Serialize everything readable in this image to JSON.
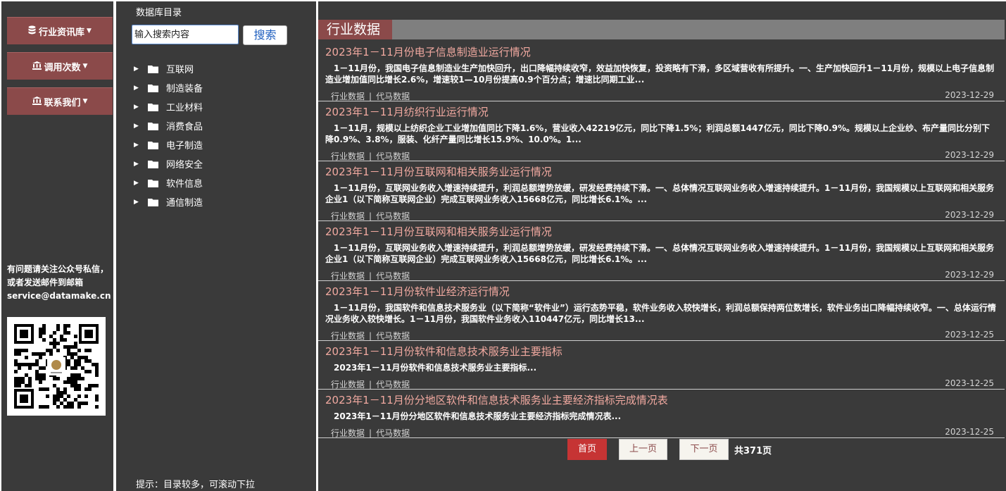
{
  "nav": {
    "items": [
      {
        "label": "行业资讯库",
        "icon": "database-icon"
      },
      {
        "label": "调用次数",
        "icon": "bank-icon"
      },
      {
        "label": "联系我们",
        "icon": "bank-icon"
      }
    ],
    "contact_text": "有问题请关注公众号私信，或者发送邮件到邮箱",
    "contact_email": "service@datamake.cn"
  },
  "catalog": {
    "title": "数据库目录",
    "search_placeholder": "输入搜索内容",
    "search_label": "搜索",
    "tree": [
      "互联网",
      "制造装备",
      "工业材料",
      "消费食品",
      "电子制造",
      "网络安全",
      "软件信息",
      "通信制造"
    ],
    "hint": "提示：目录较多，可滚动下拉"
  },
  "main": {
    "title": "行业数据",
    "articles": [
      {
        "title": "2023年1－11月份电子信息制造业运行情况",
        "summary": "1－11月份，我国电子信息制造业生产加快回升，出口降幅持续收窄，效益加快恢复，投资略有下滑，多区域营收有所提升。一、生产加快回升1－11月份，规模以上电子信息制造业增加值同比增长2.6%，增速较1—10月份提高0.9个百分点；增速比同期工业...",
        "category": "行业数据",
        "source": "代马数据",
        "date": "2023-12-29"
      },
      {
        "title": "2023年1－11月纺织行业运行情况",
        "summary": "1－11月，规模以上纺织企业工业增加值同比下降1.6%，营业收入42219亿元，同比下降1.5%；利润总额1447亿元，同比下降0.9%。规模以上企业纱、布产量同比分别下降0.9%、3.8%，服装、化纤产量同比增长15.9%、10.0%。1...",
        "category": "行业数据",
        "source": "代马数据",
        "date": "2023-12-29"
      },
      {
        "title": "2023年1－11月份互联网和相关服务业运行情况",
        "summary": "1－11月份，互联网业务收入增速持续提升，利润总额增势放缓，研发经费持续下滑。一、总体情况互联网业务收入增速持续提升。1－11月份，我国规模以上互联网和相关服务企业1（以下简称互联网企业）完成互联网业务收入15668亿元，同比增长6.1%。...",
        "category": "行业数据",
        "source": "代马数据",
        "date": "2023-12-29"
      },
      {
        "title": "2023年1－11月份互联网和相关服务业运行情况",
        "summary": "1－11月份，互联网业务收入增速持续提升，利润总额增势放缓，研发经费持续下滑。一、总体情况互联网业务收入增速持续提升。1－11月份，我国规模以上互联网和相关服务企业1（以下简称互联网企业）完成互联网业务收入15668亿元，同比增长6.1%。...",
        "category": "行业数据",
        "source": "代马数据",
        "date": "2023-12-29"
      },
      {
        "title": "2023年1－11月份软件业经济运行情况",
        "summary": "1－11月份，我国软件和信息技术服务业（以下简称“软件业”）运行态势平稳，软件业务收入较快增长，利润总额保持两位数增长，软件业务出口降幅持续收窄。一、总体运行情况业务收入较快增长。1－11月份，我国软件业务收入110447亿元，同比增长13...",
        "category": "行业数据",
        "source": "代马数据",
        "date": "2023-12-25"
      },
      {
        "title": "2023年1－11月份软件和信息技术服务业主要指标",
        "summary": "2023年1－11月份软件和信息技术服务业主要指标...",
        "category": "行业数据",
        "source": "代马数据",
        "date": "2023-12-25"
      },
      {
        "title": "2023年1－11月份分地区软件和信息技术服务业主要经济指标完成情况表",
        "summary": "2023年1－11月份分地区软件和信息技术服务业主要经济指标完成情况表...",
        "category": "行业数据",
        "source": "代马数据",
        "date": "2023-12-25"
      }
    ]
  },
  "pagination": {
    "first": "首页",
    "prev": "上一页",
    "next": "下一页",
    "total": "共371页"
  }
}
